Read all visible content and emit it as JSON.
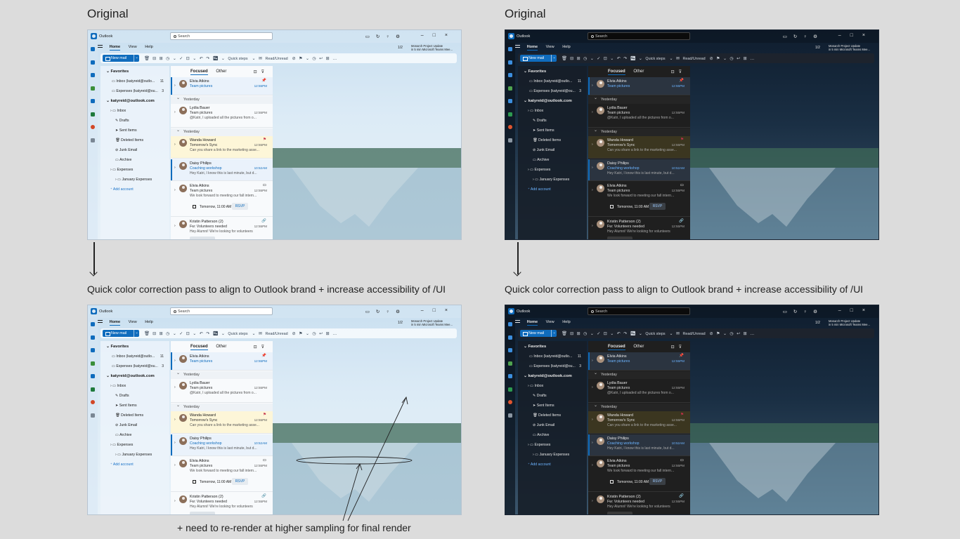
{
  "labels": {
    "top_left": "Original",
    "top_right": "Original",
    "caption_left": "Quick color correction pass to align to Outlook brand + increase accessibility of /UI",
    "caption_right": "Quick color correction pass to align to Outlook brand + increase accessibility of /UI",
    "annotation": "+ need to re-render at higher sampling for final render"
  },
  "outlook": {
    "app_name": "Outlook",
    "search_placeholder": "Search",
    "tabs": [
      "Home",
      "View",
      "Help"
    ],
    "page_indicator": "1/2",
    "reminder_title": "Monarch Project Update",
    "reminder_detail": "in 5 min Microsoft Teams Mee...",
    "new_mail": "New mail",
    "quick_steps": "Quick steps",
    "read_unread": "Read/Unread",
    "folders": {
      "favorites": "Favorites",
      "fav_inbox": "Inbox (katyreid@outlo...",
      "fav_inbox_count": "11",
      "fav_expenses": "Expenses (katyreid@ou...",
      "fav_expenses_count": "3",
      "account": "katyreid@outlook.com",
      "inbox": "Inbox",
      "drafts": "Drafts",
      "sent": "Sent Items",
      "deleted": "Deleted Items",
      "junk": "Junk Email",
      "archive": "Archive",
      "expenses": "Expenses",
      "jan_expenses": "January Expenses",
      "add_account": "Add account"
    },
    "list": {
      "focused": "Focused",
      "other": "Other",
      "group_yesterday": "Yesterday",
      "rsvp": "RSVP",
      "m1": {
        "sender": "Elvia Atkins",
        "subject": "Team pictures",
        "time": "12:55PM"
      },
      "m2": {
        "sender": "Lydia Bauer",
        "subject": "Team pictures",
        "time": "12:55PM",
        "preview": "@Katri, I uploaded all the pictures from o..."
      },
      "m3": {
        "sender": "Wanda Howard",
        "subject": "Tomorrow's Sync",
        "time": "12:55PM",
        "preview": "Can you share a link to the marketing asse..."
      },
      "m4": {
        "sender": "Daisy Philips",
        "subject": "Coaching workshop",
        "time": "10:52AM",
        "preview": "Hey Katri, I know this is last minute, but d..."
      },
      "m5": {
        "sender": "Elvia Atkins",
        "subject": "Team pictures",
        "time": "12:55PM",
        "preview": "We look forward to meeting our fall intern...",
        "meeting": "Tomorrow, 11:00 AM (30m)"
      },
      "m6": {
        "sender": "Kristin Patterson (2)",
        "subject": "Fw: Volunteers needed",
        "time": "12:55PM",
        "preview": "Hey Alumni! We're looking for volunteers"
      }
    }
  }
}
